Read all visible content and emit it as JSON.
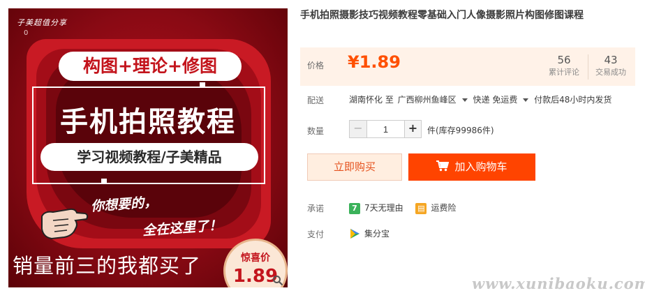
{
  "product_image": {
    "brand": "子美超值分享",
    "brand_count": "0",
    "topic": "构图+理论+修图",
    "main_title": "手机拍照教程",
    "subtitle": "学习视频教程/子美精品",
    "handwritten_1": "你想要的，",
    "handwritten_2": "全在这里了！",
    "bottom_text": "销量前三的我都买了",
    "badge_label": "惊喜价",
    "badge_price": "1.89"
  },
  "product": {
    "title": "手机拍照摄影技巧视频教程零基础入门人像摄影照片构图修图课程"
  },
  "price_panel": {
    "label": "价格",
    "price": "¥1.89",
    "reviews_count": "56",
    "reviews_label": "累计评论",
    "deals_count": "43",
    "deals_label": "交易成功"
  },
  "delivery": {
    "label": "配送",
    "from": "湖南怀化 至",
    "to": "广西柳州鱼峰区",
    "shipping": "快递 免运费",
    "note": "付款后48小时内发货"
  },
  "quantity": {
    "label": "数量",
    "minus": "−",
    "value": "1",
    "plus": "+",
    "stock": "件(库存99986件)"
  },
  "actions": {
    "buy_now": "立即购买",
    "add_to_cart": "加入购物车"
  },
  "promise": {
    "label": "承诺",
    "item1_icon": "7",
    "item1": "7天无理由",
    "item2": "运费险"
  },
  "payment": {
    "label": "支付",
    "method": "集分宝"
  },
  "watermark": "www.xunibaoku.com",
  "colors": {
    "accent": "#ff5000",
    "cart_button": "#ff4400",
    "buy_button_bg": "#ffeee0",
    "price_panel_bg": "#fff2e8"
  }
}
